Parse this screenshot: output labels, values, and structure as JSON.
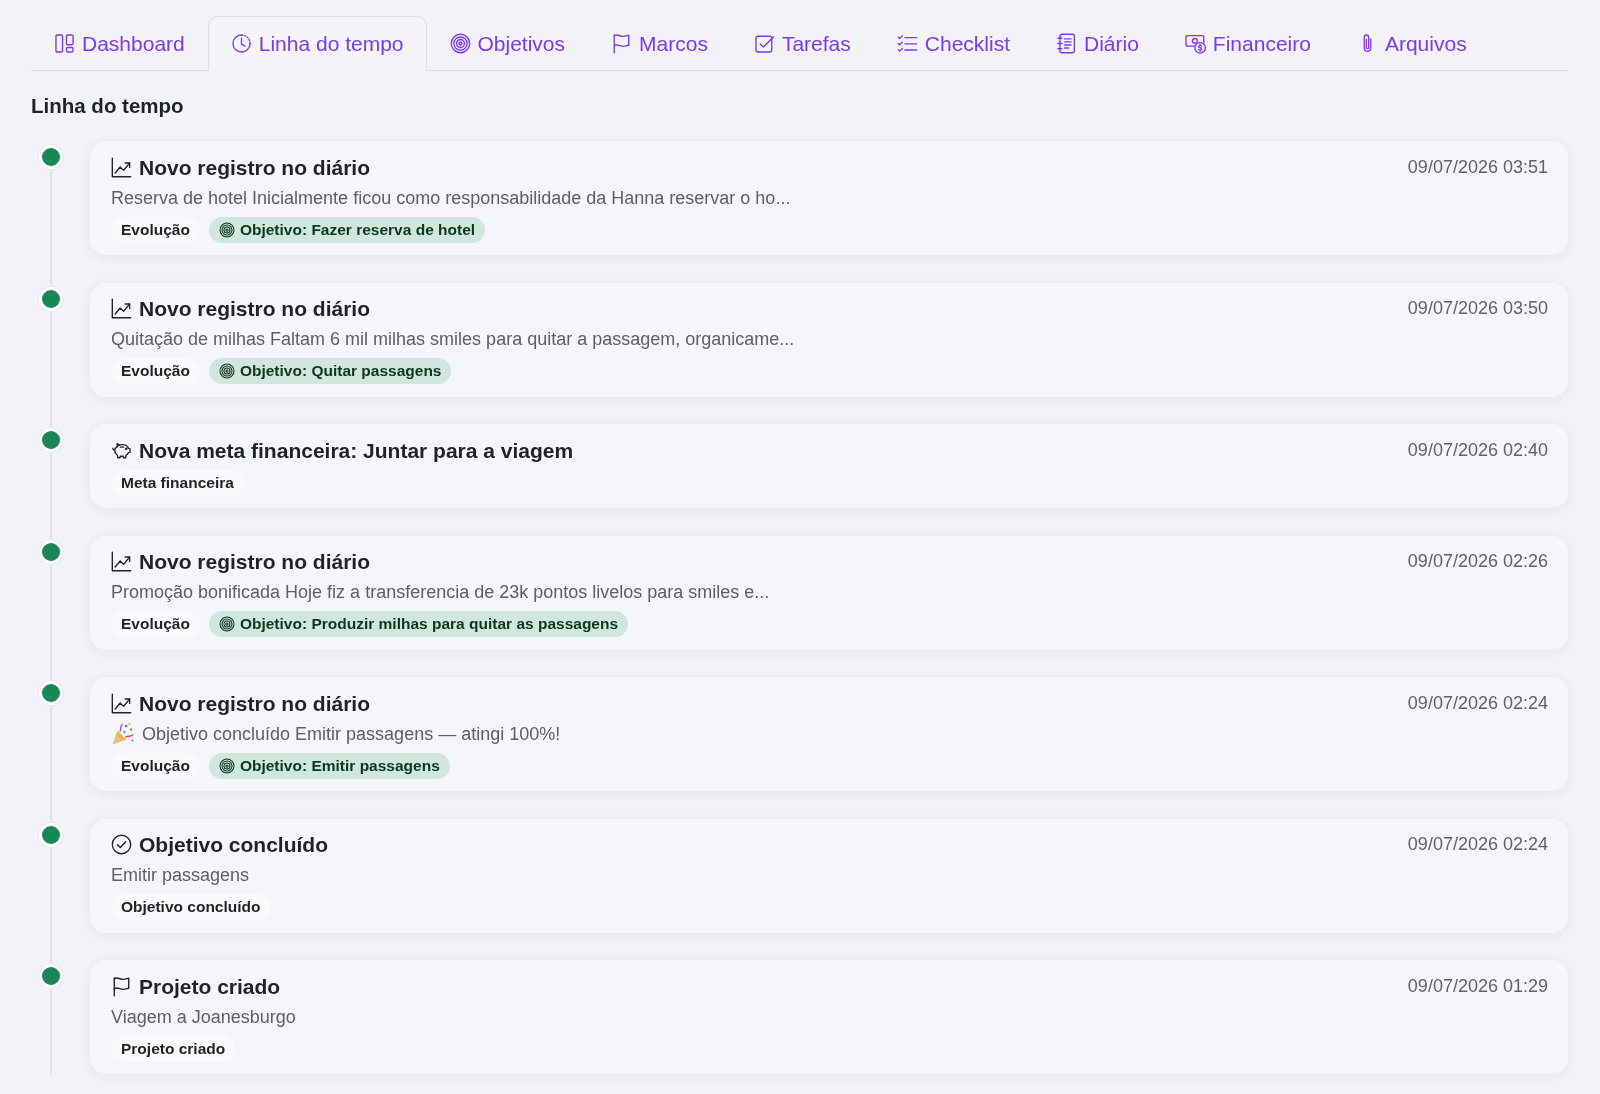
{
  "tabs": [
    {
      "kind": "dashboard",
      "label": "Dashboard",
      "selected": false
    },
    {
      "kind": "timeline",
      "label": "Linha do tempo",
      "selected": true
    },
    {
      "kind": "goals",
      "label": "Objetivos",
      "selected": false
    },
    {
      "kind": "milestones",
      "label": "Marcos",
      "selected": false
    },
    {
      "kind": "tasks",
      "label": "Tarefas",
      "selected": false
    },
    {
      "kind": "checklist",
      "label": "Checklist",
      "selected": false
    },
    {
      "kind": "journal",
      "label": "Diário",
      "selected": false
    },
    {
      "kind": "finance",
      "label": "Financeiro",
      "selected": false
    },
    {
      "kind": "files",
      "label": "Arquivos",
      "selected": false
    }
  ],
  "section_title": "Linha do tempo",
  "events": [
    {
      "kind": "journal",
      "title": "Novo registro no diário",
      "date": "09/07/2026 03:51",
      "celebration": false,
      "description": "Reserva de hotel Inicialmente ficou como responsabilidade da Hanna reservar o ho...",
      "tags": [
        {
          "kind": "category",
          "label": "Evolução"
        },
        {
          "kind": "goal",
          "label": "Objetivo: Fazer reserva de hotel"
        }
      ]
    },
    {
      "kind": "journal",
      "title": "Novo registro no diário",
      "date": "09/07/2026 03:50",
      "celebration": false,
      "description": "Quitação de milhas Faltam 6 mil milhas smiles para quitar a passagem, organicame...",
      "tags": [
        {
          "kind": "category",
          "label": "Evolução"
        },
        {
          "kind": "goal",
          "label": "Objetivo: Quitar passagens"
        }
      ]
    },
    {
      "kind": "savings",
      "title": "Nova meta financeira: Juntar para a viagem",
      "date": "09/07/2026 02:40",
      "tags": [
        {
          "kind": "category",
          "label": "Meta financeira"
        }
      ]
    },
    {
      "kind": "journal",
      "title": "Novo registro no diário",
      "date": "09/07/2026 02:26",
      "celebration": false,
      "description": "Promoção bonificada Hoje fiz a transferencia de 23k pontos livelos para smiles e...",
      "tags": [
        {
          "kind": "category",
          "label": "Evolução"
        },
        {
          "kind": "goal",
          "label": "Objetivo: Produzir milhas para quitar as passagens"
        }
      ]
    },
    {
      "kind": "journal",
      "title": "Novo registro no diário",
      "date": "09/07/2026 02:24",
      "celebration": true,
      "description": "Objetivo concluído Emitir passagens — atingi 100%!",
      "tags": [
        {
          "kind": "category",
          "label": "Evolução"
        },
        {
          "kind": "goal",
          "label": "Objetivo: Emitir passagens"
        }
      ]
    },
    {
      "kind": "completion",
      "title": "Objetivo concluído",
      "date": "09/07/2026 02:24",
      "celebration": false,
      "description": "Emitir passagens",
      "tags": [
        {
          "kind": "category",
          "label": "Objetivo concluído"
        }
      ]
    },
    {
      "kind": "project",
      "title": "Projeto criado",
      "date": "09/07/2026 01:29",
      "celebration": false,
      "description": "Viagem a Joanesburgo",
      "tags": [
        {
          "kind": "category",
          "label": "Projeto criado"
        }
      ]
    }
  ]
}
